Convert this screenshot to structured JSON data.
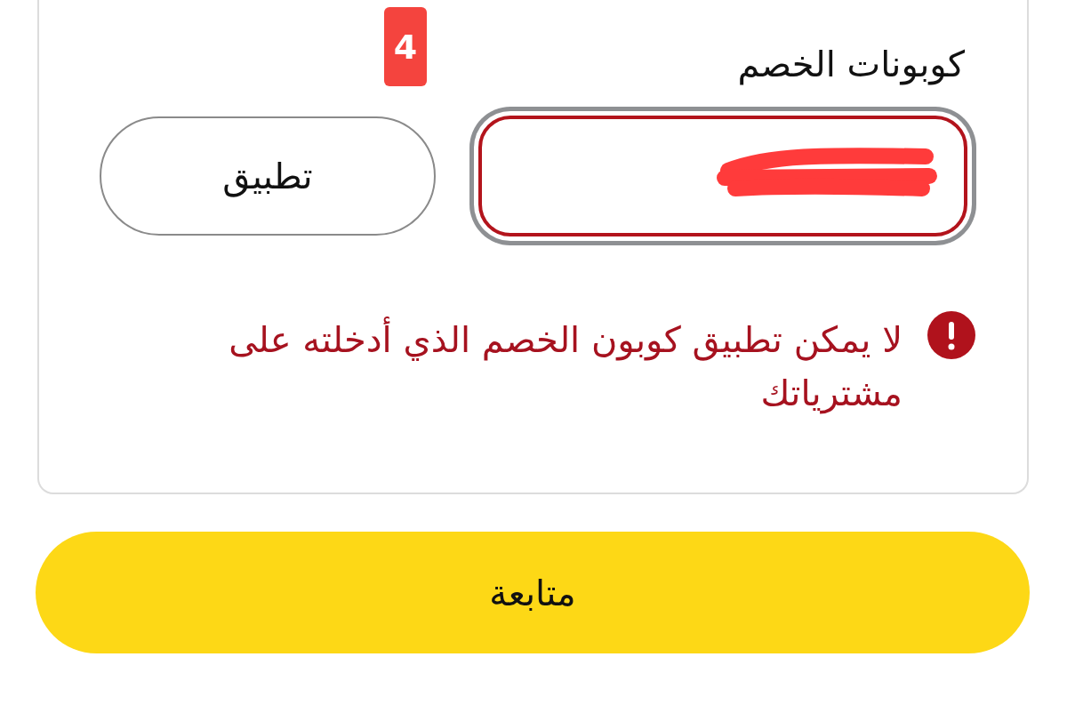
{
  "coupon_section": {
    "step_badge": "4",
    "label": "كوبونات الخصم",
    "field": {
      "error": true,
      "focused": true,
      "redacted": true
    },
    "apply_button": "تطبيق",
    "error_message": "لا يمكن تطبيق كوبون الخصم الذي أدخلته على مشترياتك"
  },
  "continue_button": "متابعة"
}
